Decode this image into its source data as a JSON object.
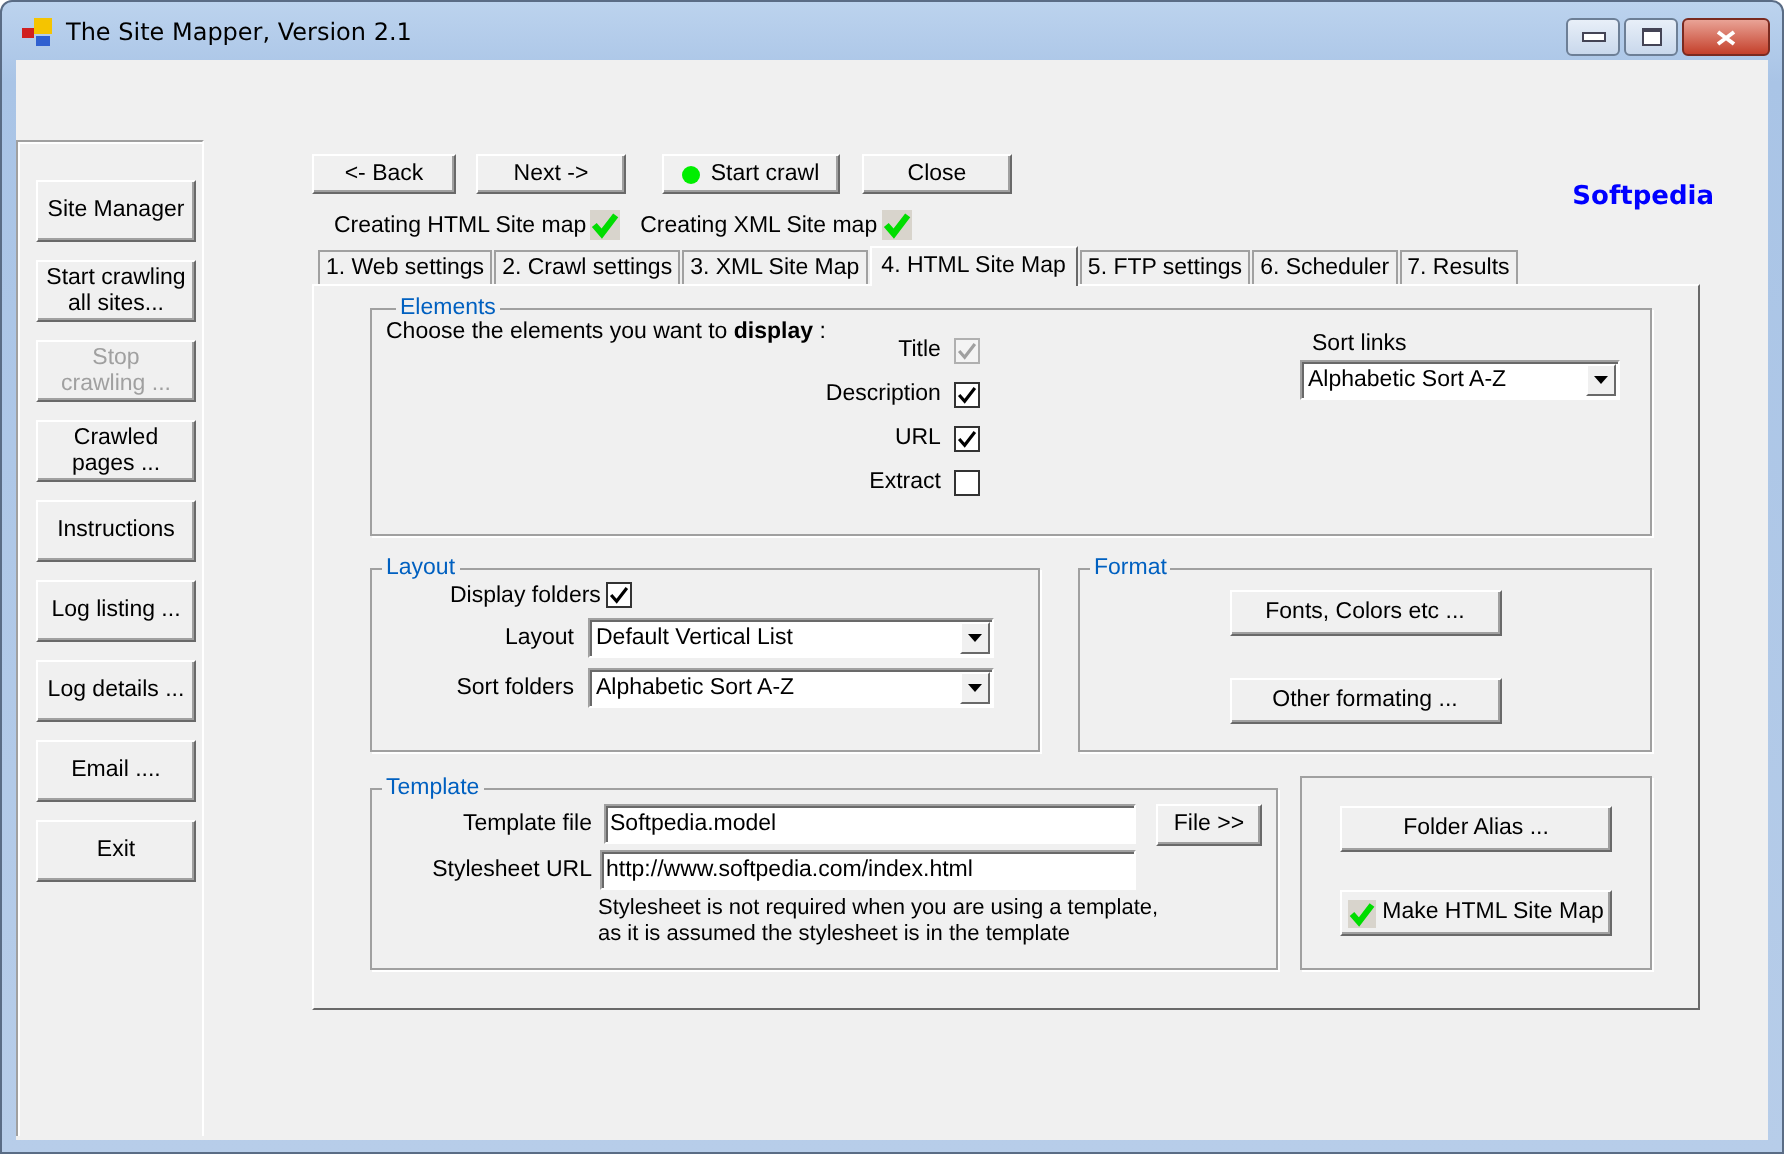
{
  "window": {
    "title": "The Site Mapper, Version 2.1"
  },
  "sidebar": {
    "buttons": [
      {
        "label": "Site Manager",
        "disabled": false
      },
      {
        "label": "Start crawling\nall sites...",
        "disabled": false
      },
      {
        "label": "Stop\ncrawling ...",
        "disabled": true
      },
      {
        "label": "Crawled\npages ...",
        "disabled": false
      },
      {
        "label": "Instructions",
        "disabled": false
      },
      {
        "label": "Log listing ...",
        "disabled": false
      },
      {
        "label": "Log details ...",
        "disabled": false
      },
      {
        "label": "Email ....",
        "disabled": false
      },
      {
        "label": "Exit",
        "disabled": false
      }
    ]
  },
  "toolbar": {
    "buttons": [
      {
        "label": "<- Back",
        "kind": "plain"
      },
      {
        "label": "Next ->",
        "kind": "plain"
      },
      {
        "label": "Start crawl",
        "kind": "status"
      },
      {
        "label": "Close",
        "kind": "plain"
      }
    ]
  },
  "brand": "Softpedia",
  "progress_flags": [
    {
      "label": "Creating HTML Site map",
      "checked": true
    },
    {
      "label": "Creating XML Site map",
      "checked": true
    }
  ],
  "tabs": [
    {
      "label": "1. Web settings",
      "selected": false
    },
    {
      "label": "2. Crawl settings",
      "selected": false
    },
    {
      "label": "3. XML Site Map",
      "selected": false
    },
    {
      "label": "4. HTML Site Map",
      "selected": true
    },
    {
      "label": "5. FTP settings",
      "selected": false
    },
    {
      "label": "6. Scheduler",
      "selected": false
    },
    {
      "label": "7. Results",
      "selected": false
    }
  ],
  "elements": {
    "title": "Elements",
    "prompt": "Choose the elements you want to **display** :",
    "options": [
      {
        "label": "Title",
        "checked": true,
        "disabled": true
      },
      {
        "label": "Description",
        "checked": true,
        "disabled": false
      },
      {
        "label": "URL",
        "checked": true,
        "disabled": false
      },
      {
        "label": "Extract",
        "checked": false,
        "disabled": false
      }
    ],
    "sort_links": {
      "label": "Sort links",
      "value": "Alphabetic Sort A-Z"
    }
  },
  "layout": {
    "title": "Layout",
    "display_folders": {
      "label": "Display folders",
      "checked": true
    },
    "layout": {
      "label": "Layout",
      "value": "Default Vertical List"
    },
    "sort_folders": {
      "label": "Sort folders",
      "value": "Alphabetic Sort A-Z"
    }
  },
  "format": {
    "title": "Format",
    "buttons": [
      "Fonts, Colors etc ...",
      "Other formating ..."
    ]
  },
  "template": {
    "title": "Template",
    "template_file": {
      "label": "Template file",
      "value": "Softpedia.model"
    },
    "file_button": "File >>",
    "stylesheet_url": {
      "label": "Stylesheet URL",
      "value": "http://www.softpedia.com/index.html"
    },
    "note": "Stylesheet is not required when you are using a template,\nas it is assumed the stylesheet is in the template"
  },
  "actions": {
    "buttons": [
      {
        "label": "Folder Alias ...",
        "kind": "plain"
      },
      {
        "label": "Make HTML Site Map",
        "kind": "check",
        "checked": true
      }
    ]
  }
}
